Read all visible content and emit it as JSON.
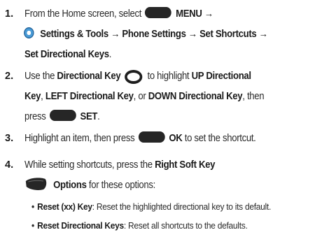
{
  "steps": [
    {
      "number": "1.",
      "line1": {
        "prefix": "From the Home screen, select",
        "menu": "MENU",
        "arrow": "→"
      },
      "line2": {
        "settings": "Settings & Tools",
        "arrow1": "→",
        "phone": "Phone Settings",
        "arrow2": "→",
        "shortcuts": "Set Shortcuts",
        "arrow3": "→"
      },
      "line3": {
        "directional": "Set Directional Keys",
        "period": "."
      }
    },
    {
      "number": "2.",
      "line1": {
        "use": "Use the",
        "key": "Directional Key",
        "highlight": "to highlight",
        "up": "UP Directional"
      },
      "line2": {
        "key_word": "Key",
        "comma1": ",",
        "left": "LEFT Directional Key",
        "or": ", or",
        "down": "DOWN Directional Key",
        "then": ", then"
      },
      "line3": {
        "press": "press",
        "set": "SET",
        "period": "."
      }
    },
    {
      "number": "3.",
      "line1": {
        "text": "Highlight an item, then press",
        "ok": "OK",
        "rest": "to set the shortcut."
      }
    },
    {
      "number": "4.",
      "line1": {
        "text": "While setting shortcuts, press the",
        "key": "Right Soft Key"
      },
      "line2": {
        "options": "Options",
        "rest": "for these options:"
      },
      "bullets": [
        {
          "bullet": "•",
          "term": "Reset (xx) Key",
          "desc": ": Reset the highlighted directional key to its default."
        },
        {
          "bullet": "•",
          "term": "Reset Directional Keys",
          "desc": ": Reset all shortcuts to the defaults."
        }
      ]
    }
  ],
  "icons": {
    "menu_key": "menu-key-icon",
    "settings": "settings-tools-icon",
    "directional": "directional-key-icon",
    "set_key": "set-key-icon",
    "ok_key": "ok-key-icon",
    "soft_key": "right-soft-key-icon"
  },
  "colors": {
    "text": "#2b2b2b",
    "key_fill": "#262626",
    "settings_blue": "#4a9bd6"
  }
}
